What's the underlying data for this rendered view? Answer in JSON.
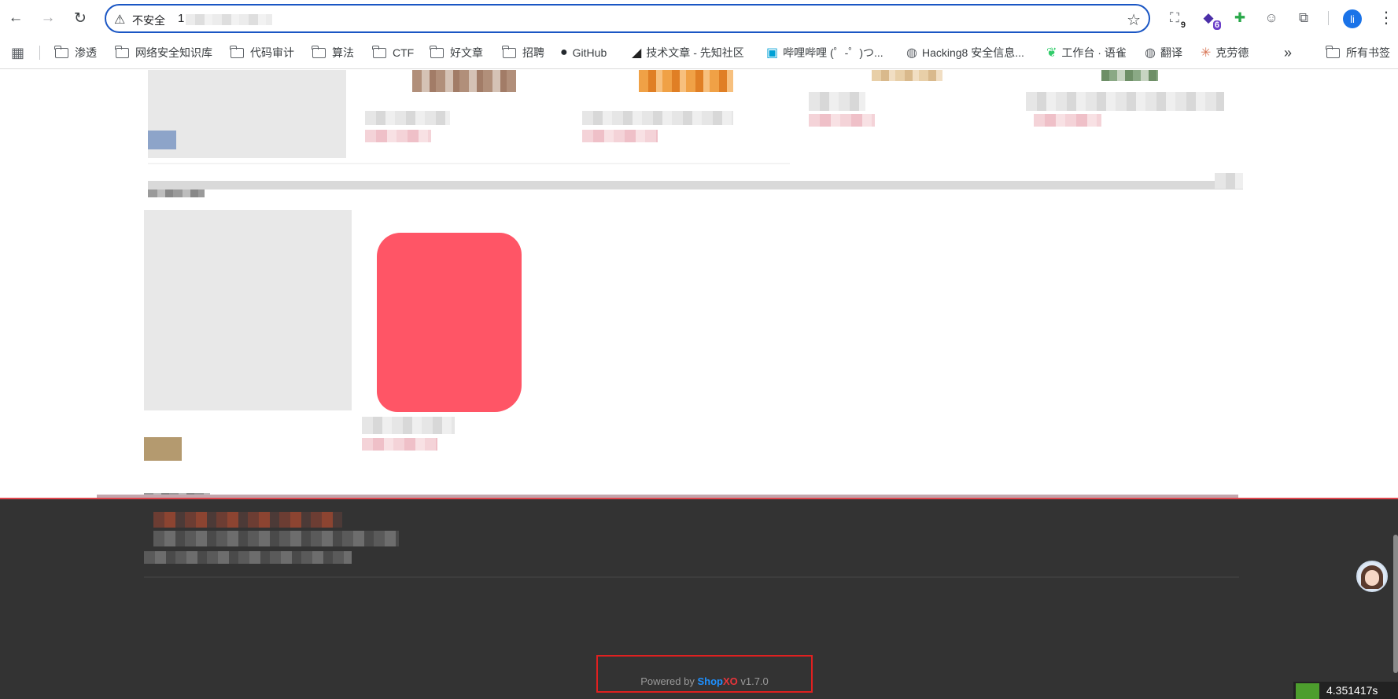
{
  "browser": {
    "security_label": "不安全",
    "url_visible": "1",
    "extension_badges": {
      "ext1": "9",
      "ext2": "6"
    },
    "profile_initial": "li",
    "bookmarks": [
      {
        "label": "渗透",
        "icon": "folder-icon"
      },
      {
        "label": "网络安全知识库",
        "icon": "folder-icon"
      },
      {
        "label": "代码审计",
        "icon": "folder-icon"
      },
      {
        "label": "算法",
        "icon": "folder-icon"
      },
      {
        "label": "CTF",
        "icon": "folder-icon"
      },
      {
        "label": "好文章",
        "icon": "folder-icon"
      },
      {
        "label": "招聘",
        "icon": "folder-icon"
      },
      {
        "label": "GitHub",
        "icon": "github-icon"
      },
      {
        "label": "技术文章 - 先知社区",
        "icon": "xianzhi-icon"
      },
      {
        "label": "哔哩哔哩 (゜-゜)つ...",
        "icon": "bilibili-icon"
      },
      {
        "label": "Hacking8 安全信息...",
        "icon": "globe-icon"
      },
      {
        "label": "工作台 · 语雀",
        "icon": "yuque-icon"
      },
      {
        "label": "翻译",
        "icon": "globe-icon"
      },
      {
        "label": "克劳德",
        "icon": "claude-icon"
      }
    ],
    "overflow_label": "»",
    "all_bookmarks_label": "所有书签"
  },
  "footer": {
    "powered_prefix": "Powered by ",
    "brand_shop": "Shop",
    "brand_xo": "XO",
    "version": " v1.7.0"
  },
  "status": {
    "timer": "4.351417s"
  },
  "colors": {
    "accent_blue": "#1a56c4",
    "redaction": "#ff5566",
    "footer_bg": "#333333",
    "brand_shop": "#1e90ff",
    "brand_xo": "#e8353b"
  }
}
